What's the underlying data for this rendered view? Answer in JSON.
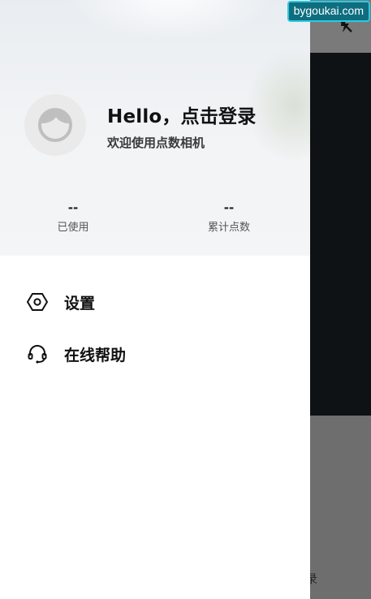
{
  "watermark": "bygoukai.com",
  "drawer": {
    "header": {
      "greeting": "Hello，点击登录",
      "subtitle": "欢迎使用点数相机",
      "stats": [
        {
          "value": "--",
          "label": "已使用"
        },
        {
          "value": "--",
          "label": "累计点数"
        }
      ]
    },
    "menu": [
      {
        "icon": "hexagon-settings-icon",
        "label": "设置"
      },
      {
        "icon": "headset-icon",
        "label": "在线帮助"
      }
    ]
  },
  "background": {
    "login_fragment": "录",
    "topbar_icon": "flash-off-icon"
  },
  "colors": {
    "watermark_bg": "#0e6e80",
    "watermark_border": "#2cc9e0",
    "bg_dark": "#0f1215",
    "bg_overlay": "#6e6e6e"
  }
}
